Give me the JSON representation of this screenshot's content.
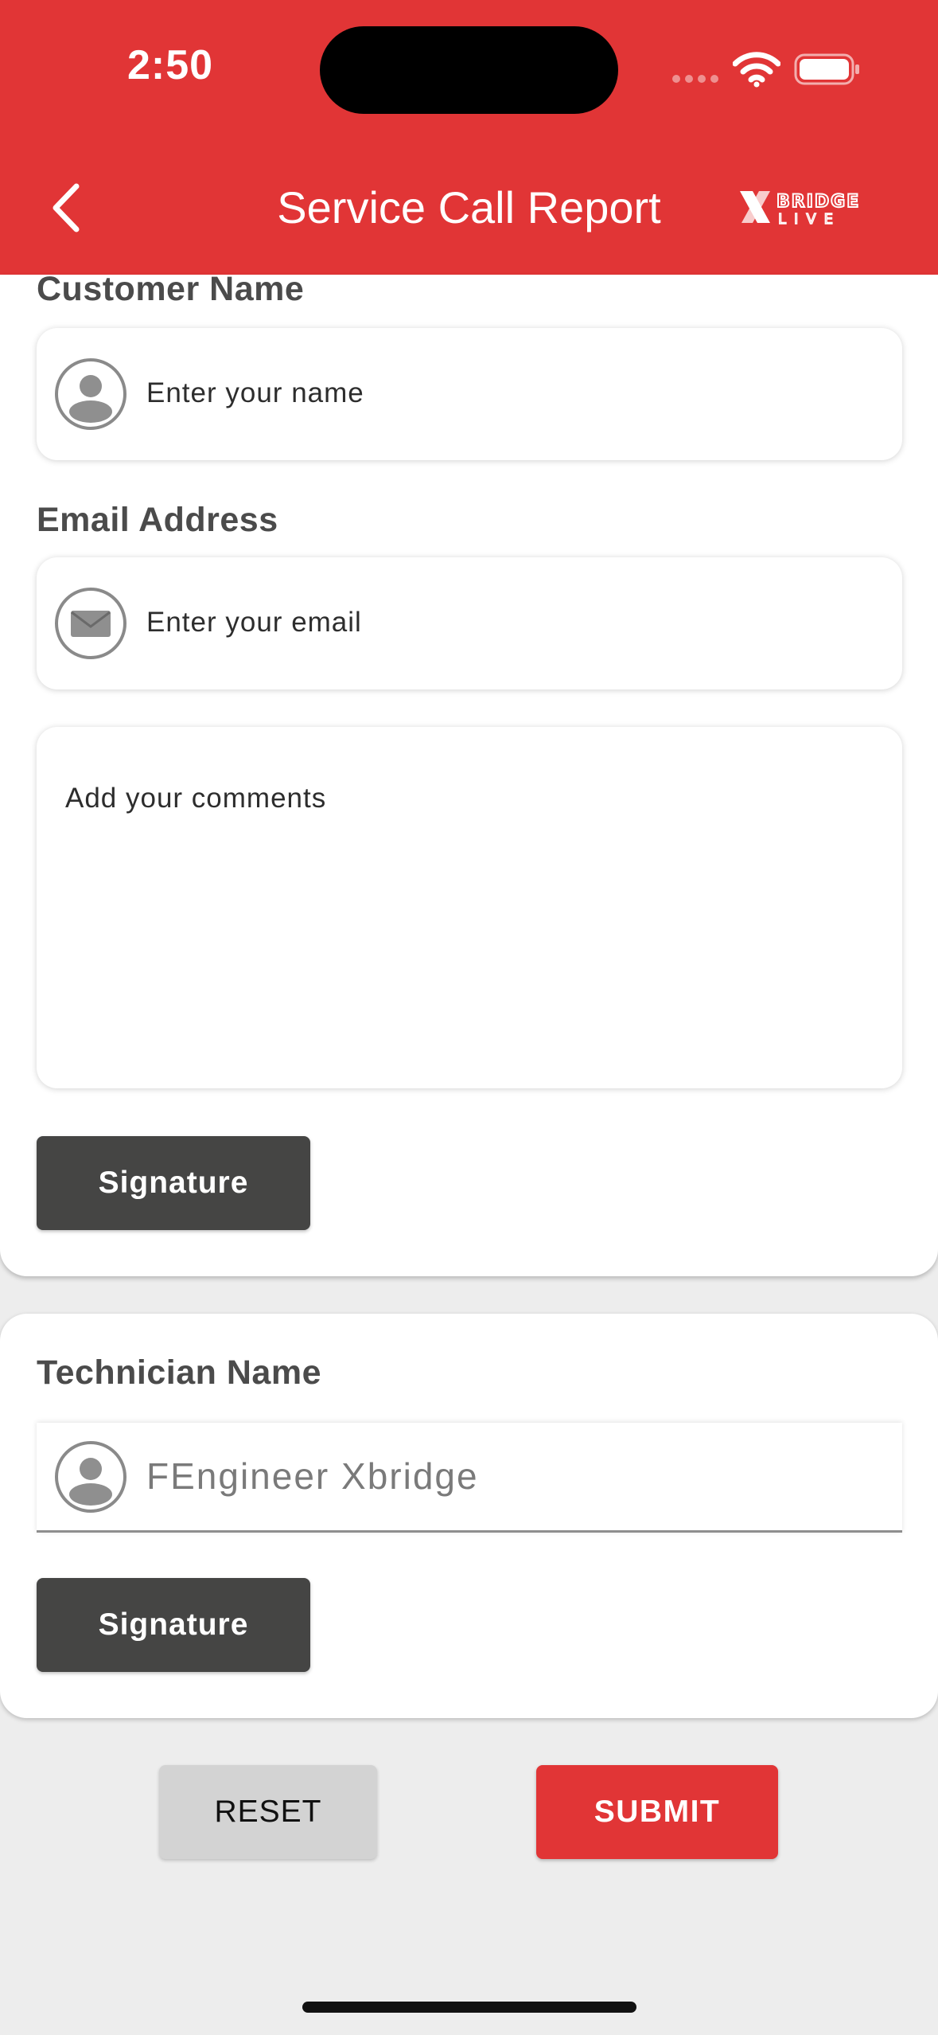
{
  "status_bar": {
    "time": "2:50"
  },
  "header": {
    "title": "Service Call Report",
    "logo_top": "BRIDGE",
    "logo_bottom": "LIVE",
    "brand_color": "#e13536"
  },
  "customer": {
    "name_label": "Customer Name",
    "name_placeholder": "Enter your name",
    "email_label": "Email Address",
    "email_placeholder": "Enter your email",
    "comments_placeholder": "Add your comments",
    "signature_label": "Signature"
  },
  "technician": {
    "name_label": "Technician Name",
    "name_value": "FEngineer Xbridge",
    "signature_label": "Signature"
  },
  "actions": {
    "reset_label": "RESET",
    "submit_label": "SUBMIT"
  },
  "icons": {
    "back": "chevron-left-icon",
    "user": "user-icon",
    "mail": "envelope-icon",
    "wifi": "wifi-icon",
    "battery": "battery-icon"
  }
}
